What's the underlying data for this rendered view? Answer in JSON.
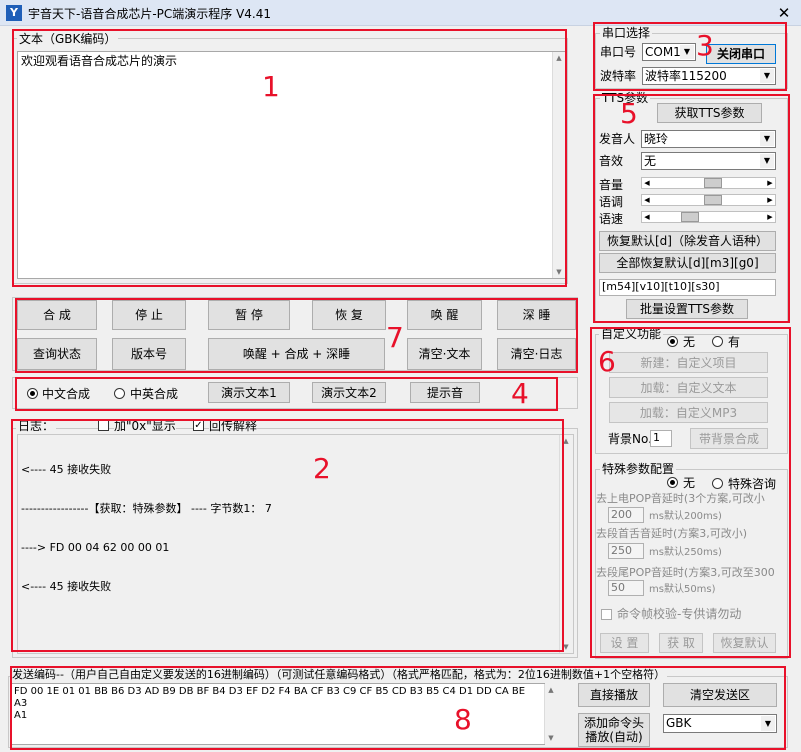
{
  "window": {
    "title": "宇音天下-语音合成芯片-PC端演示程序 V4.41",
    "app_icon": "Y",
    "close": "✕"
  },
  "text_panel": {
    "label": "文本（GBK编码）",
    "content": "欢迎观看语音合成芯片的演示"
  },
  "serial": {
    "label": "串口选择",
    "port_label": "串口号",
    "port_value": "COM11",
    "close_button": "关闭串口",
    "baud_label": "波特率",
    "baud_value": "波特率115200"
  },
  "tts": {
    "label": "TTS参数",
    "get_button": "获取TTS参数",
    "voice_label": "发音人",
    "voice_value": "晓玲",
    "effect_label": "音效",
    "effect_value": "无",
    "volume_label": "音量",
    "volume_level": 0.55,
    "pitch_label": "语调",
    "pitch_level": 0.55,
    "speed_label": "语速",
    "speed_level": 0.3,
    "reset_button": "恢复默认[d]（除发音人语种）",
    "reset_all_button": "全部恢复默认[d][m3][g0]",
    "param_string": "[m54][v10][t10][s30]",
    "batch_button": "批量设置TTS参数"
  },
  "controls": {
    "row1": [
      "合 成",
      "停 止",
      "暂 停",
      "恢 复",
      "唤 醒",
      "深 睡"
    ],
    "row2_query": "查询状态",
    "row2_version": "版本号",
    "row2_combo": "唤醒 + 合成 + 深睡",
    "row2_clear_text": "清空·文本",
    "row2_clear_log": "清空·日志"
  },
  "mode": {
    "chinese": "中文合成",
    "mixed": "中英合成",
    "demo1": "演示文本1",
    "demo2": "演示文本2",
    "prompt": "提示音"
  },
  "custom": {
    "label": "自定义功能",
    "none": "无",
    "yes": "有",
    "new_button": "新建：自定义项目",
    "load_text": "加载：自定义文本",
    "load_mp3": "加载：自定义MP3",
    "bg_label": "背景No.",
    "bg_value": "1",
    "bg_button": "带背景合成"
  },
  "special": {
    "label": "特殊参数配置",
    "none": "无",
    "consult": "特殊咨询",
    "pop_up_label": "去上电POP音延时(3个方案,可改小",
    "pop_up_value": "200",
    "pop_up_unit": "ms默认200ms)",
    "tongue_label": "去段首舌音延时(方案3,可改小)",
    "tongue_value": "250",
    "tongue_unit": "ms默认250ms)",
    "pop_end_label": "去段尾POP音延时(方案3,可改至300",
    "pop_end_value": "50",
    "pop_end_unit": "ms默认50ms)",
    "verify_label": "命令帧校验-专供请勿动",
    "set_button": "设 置",
    "get_button": "获 取",
    "reset_button": "恢复默认"
  },
  "log": {
    "label": "日志：",
    "hex_label": "加\"0x\"显示",
    "explain_label": "回传解释",
    "lines": [
      "<---- 45 接收失败",
      "-----------------【获取：特殊参数】 ---- 字节数1： 7",
      "----> FD 00 04 62 00 00 01",
      "<---- 45 接收失败"
    ]
  },
  "send": {
    "label": "发送编码--（用户自己自由定义要发送的16进制编码）（可测试任意编码格式）（格式严格匹配，格式为：2位16进制数值+1个空格符）",
    "content": "FD 00 1E 01 01 BB B6 D3 AD B9 DB BF B4 D3 EF D2 F4 BA CF B3 C9 CF B5 CD B3 B5 C4 D1 DD CA BE A3\nA1",
    "play_button": "直接播放",
    "clear_button": "清空发送区",
    "add_button_line1": "添加命令头",
    "add_button_line2": "播放(自动)",
    "encoding_value": "GBK"
  },
  "annotations": [
    "1",
    "2",
    "3",
    "4",
    "5",
    "6",
    "7",
    "8"
  ],
  "colors": {
    "annotation": "#e8112a",
    "window_bg": "#f0f0f0",
    "titlebar": "#dde6f4"
  }
}
